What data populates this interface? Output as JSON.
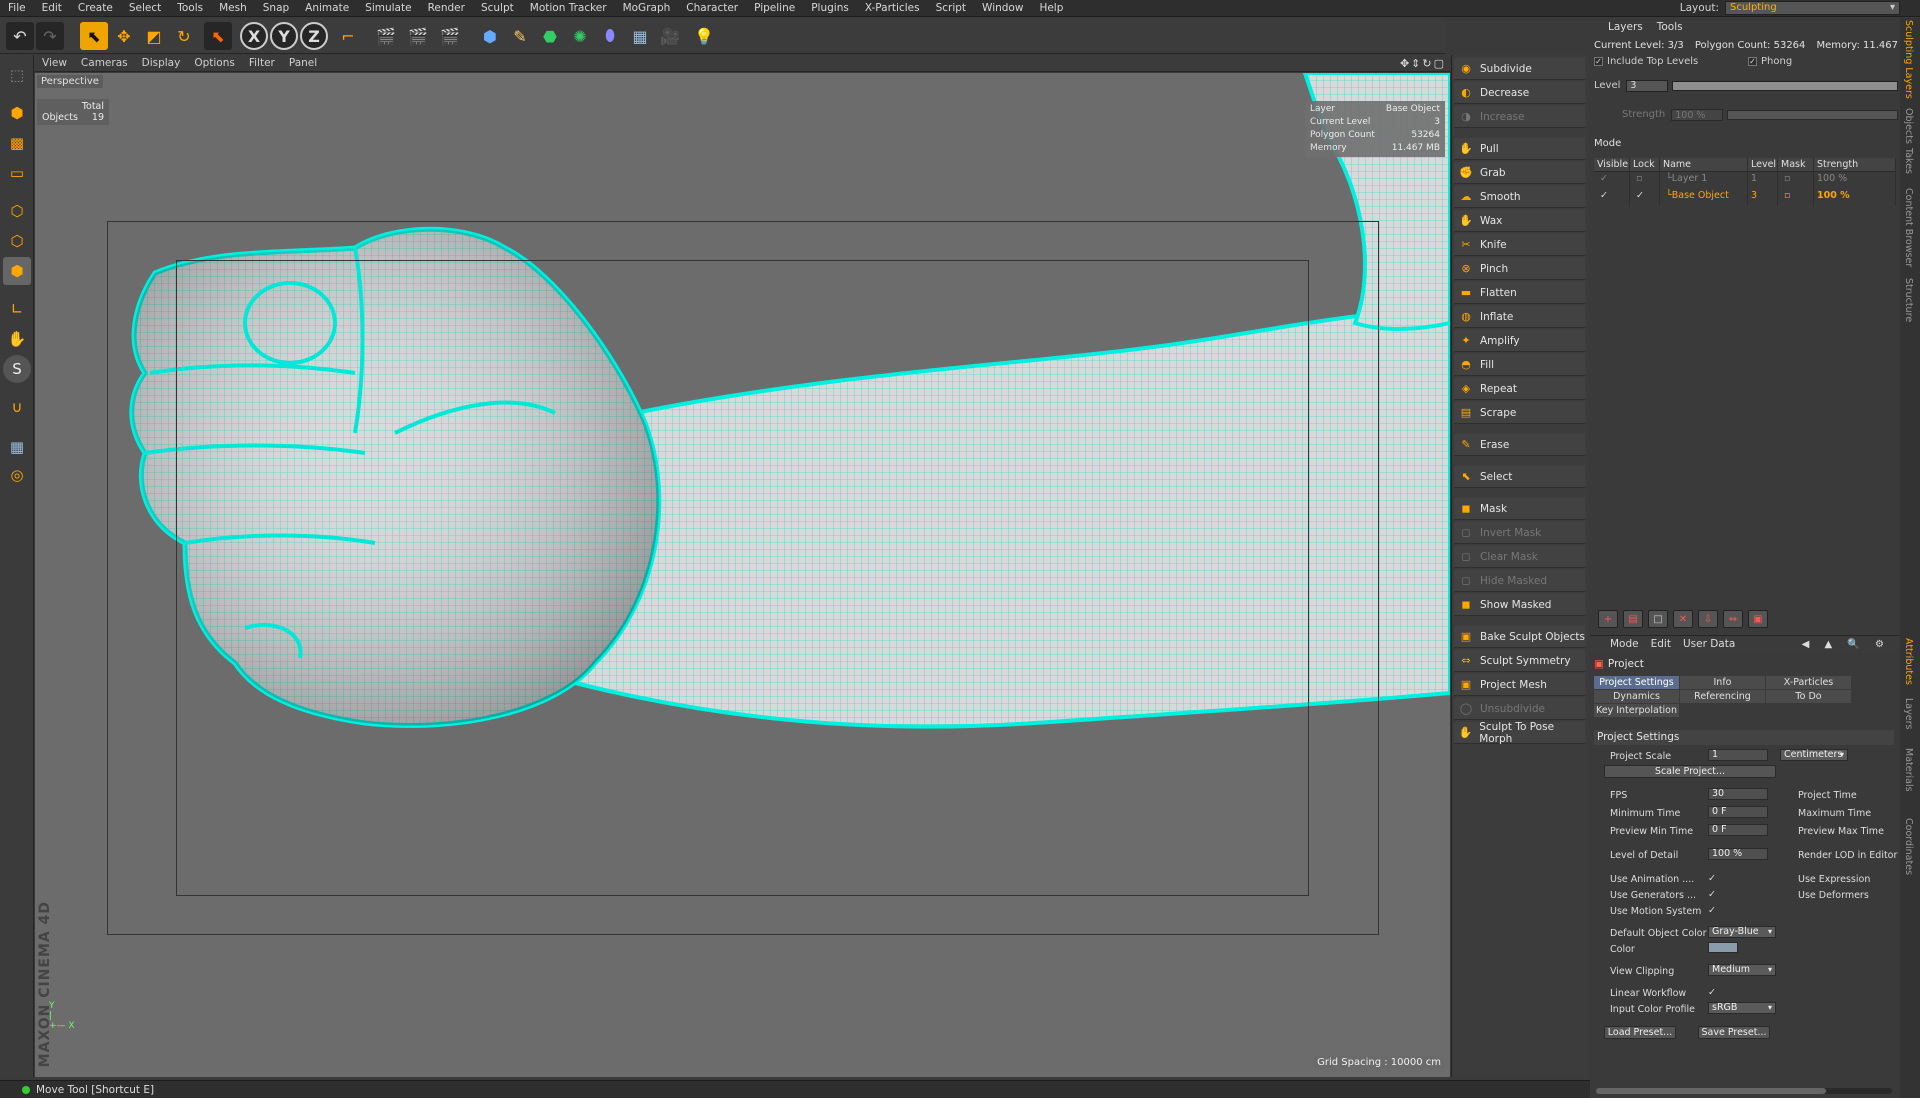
{
  "menubar": {
    "items": [
      "File",
      "Edit",
      "Create",
      "Select",
      "Tools",
      "Mesh",
      "Snap",
      "Animate",
      "Simulate",
      "Render",
      "Sculpt",
      "Motion Tracker",
      "MoGraph",
      "Character",
      "Pipeline",
      "Plugins",
      "X-Particles",
      "Script",
      "Window",
      "Help"
    ],
    "layout_label": "Layout:",
    "layout_value": "Sculpting"
  },
  "toolbar": {
    "axis_x": "X",
    "axis_y": "Y",
    "axis_z": "Z"
  },
  "viewport": {
    "menu": [
      "View",
      "Cameras",
      "Display",
      "Options",
      "Filter",
      "Panel"
    ],
    "label": "Perspective",
    "hud": {
      "total_label": "Total",
      "objects_label": "Objects",
      "objects_value": "19"
    },
    "info": {
      "layer_label": "Layer",
      "layer_value": "Base Object",
      "current_level_label": "Current Level",
      "current_level_value": "3",
      "polygon_count_label": "Polygon Count",
      "polygon_count_value": "53264",
      "memory_label": "Memory",
      "memory_value": "11.467 MB"
    },
    "grid_spacing": "Grid Spacing : 10000 cm",
    "logo": "MAXON CINEMA 4D"
  },
  "sculpt_tools": {
    "top": [
      {
        "label": "Subdivide",
        "disabled": false
      },
      {
        "label": "Decrease",
        "disabled": false
      },
      {
        "label": "Increase",
        "disabled": true
      }
    ],
    "brushes": [
      {
        "label": "Pull"
      },
      {
        "label": "Grab"
      },
      {
        "label": "Smooth"
      },
      {
        "label": "Wax"
      },
      {
        "label": "Knife"
      },
      {
        "label": "Pinch"
      },
      {
        "label": "Flatten"
      },
      {
        "label": "Inflate"
      },
      {
        "label": "Amplify"
      },
      {
        "label": "Fill"
      },
      {
        "label": "Repeat"
      },
      {
        "label": "Scrape"
      }
    ],
    "erase": "Erase",
    "select": "Select",
    "mask_group": [
      {
        "label": "Mask",
        "disabled": false
      },
      {
        "label": "Invert Mask",
        "disabled": true
      },
      {
        "label": "Clear Mask",
        "disabled": true
      },
      {
        "label": "Hide Masked",
        "disabled": true
      },
      {
        "label": "Show Masked",
        "disabled": false
      }
    ],
    "bake_group": [
      {
        "label": "Bake Sculpt Objects",
        "disabled": false
      },
      {
        "label": "Sculpt Symmetry",
        "disabled": false
      },
      {
        "label": "Project Mesh",
        "disabled": false
      },
      {
        "label": "Unsubdivide",
        "disabled": true
      },
      {
        "label": "Sculpt To Pose Morph",
        "disabled": false
      }
    ]
  },
  "layers_panel": {
    "tabs": [
      "Layers",
      "Tools"
    ],
    "current_level": "Current Level: 3/3",
    "polygon_count": "Polygon Count: 53264",
    "memory": "Memory: 11.467",
    "include_top_levels": "Include Top Levels",
    "phong": "Phong",
    "level_label": "Level",
    "level_value": "3",
    "strength_label": "Strength",
    "strength_value": "100 %",
    "mode_label": "Mode",
    "columns": [
      "Visible",
      "Lock",
      "Name",
      "Level",
      "Mask",
      "Strength"
    ],
    "rows": [
      {
        "name": "Layer 1",
        "level": "1",
        "strength": "100 %",
        "active": false
      },
      {
        "name": "Base Object",
        "level": "3",
        "strength": "100 %",
        "active": true
      }
    ]
  },
  "attributes": {
    "menu": [
      "Mode",
      "Edit",
      "User Data"
    ],
    "title": "Project",
    "tabs": [
      "Project Settings",
      "Info",
      "X-Particles",
      "Dynamics",
      "Referencing",
      "To Do",
      "Key Interpolation"
    ],
    "section": "Project Settings",
    "project_scale_label": "Project Scale",
    "project_scale_value": "1",
    "project_scale_unit": "Centimeters",
    "scale_project_btn": "Scale Project...",
    "fps_label": "FPS",
    "fps_value": "30",
    "project_time_label": "Project Time",
    "min_time_label": "Minimum Time",
    "min_time_value": "0 F",
    "max_time_label": "Maximum Time",
    "preview_min_label": "Preview Min Time",
    "preview_min_value": "0 F",
    "preview_max_label": "Preview Max Time",
    "lod_label": "Level of Detail",
    "lod_value": "100 %",
    "render_lod_label": "Render LOD in Editor",
    "use_animation": "Use Animation",
    "use_expression": "Use Expression",
    "use_generators": "Use Generators",
    "use_deformers": "Use Deformers",
    "use_motion": "Use Motion System",
    "default_color_label": "Default Object Color",
    "default_color_value": "Gray-Blue",
    "color_label": "Color",
    "view_clipping_label": "View Clipping",
    "view_clipping_value": "Medium",
    "linear_workflow_label": "Linear Workflow",
    "color_profile_label": "Input Color Profile",
    "color_profile_value": "sRGB",
    "load_preset": "Load Preset...",
    "save_preset": "Save Preset..."
  },
  "vertical_tabs": [
    "Sculpting Layers",
    "Objects",
    "Takes",
    "Content Browser",
    "Structure",
    "Attributes",
    "Layers",
    "Materials",
    "Coordinates"
  ],
  "status": {
    "text": "Move Tool [Shortcut E]"
  },
  "colors": {
    "accent": "#ffa600",
    "wireframe": "#00f0e0",
    "viewport_bg": "#6c6c6c"
  }
}
